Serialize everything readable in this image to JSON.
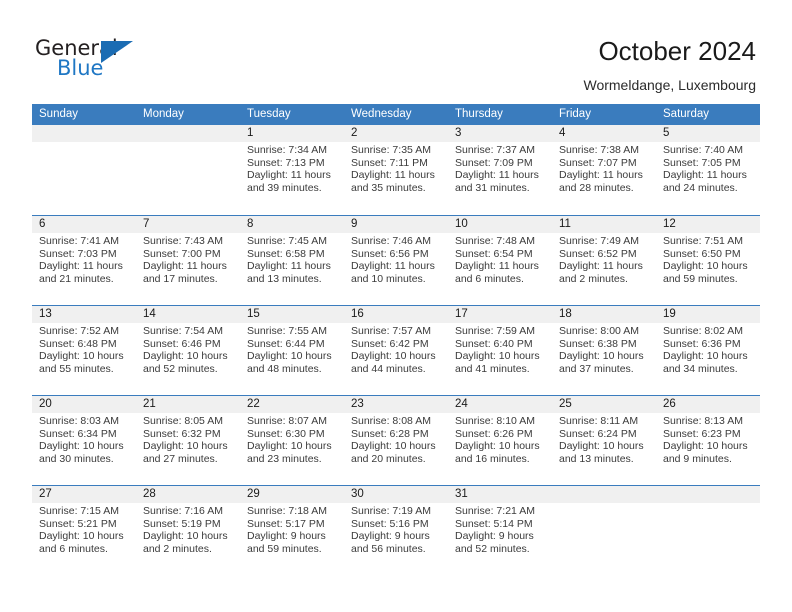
{
  "brand": {
    "name_part1": "General",
    "name_part2": "Blue",
    "triangle_icon": "triangle-icon",
    "colors": {
      "dark": "#231f20",
      "blue": "#1f77c4",
      "header_blue": "#3a7cbe"
    }
  },
  "header": {
    "title": "October 2024",
    "subtitle": "Wormeldange, Luxembourg"
  },
  "calendar": {
    "day_headers": [
      "Sunday",
      "Monday",
      "Tuesday",
      "Wednesday",
      "Thursday",
      "Friday",
      "Saturday"
    ],
    "weeks": [
      [
        {
          "day": "",
          "lines": []
        },
        {
          "day": "",
          "lines": []
        },
        {
          "day": "1",
          "lines": [
            "Sunrise: 7:34 AM",
            "Sunset: 7:13 PM",
            "Daylight: 11 hours",
            "and 39 minutes."
          ]
        },
        {
          "day": "2",
          "lines": [
            "Sunrise: 7:35 AM",
            "Sunset: 7:11 PM",
            "Daylight: 11 hours",
            "and 35 minutes."
          ]
        },
        {
          "day": "3",
          "lines": [
            "Sunrise: 7:37 AM",
            "Sunset: 7:09 PM",
            "Daylight: 11 hours",
            "and 31 minutes."
          ]
        },
        {
          "day": "4",
          "lines": [
            "Sunrise: 7:38 AM",
            "Sunset: 7:07 PM",
            "Daylight: 11 hours",
            "and 28 minutes."
          ]
        },
        {
          "day": "5",
          "lines": [
            "Sunrise: 7:40 AM",
            "Sunset: 7:05 PM",
            "Daylight: 11 hours",
            "and 24 minutes."
          ]
        }
      ],
      [
        {
          "day": "6",
          "lines": [
            "Sunrise: 7:41 AM",
            "Sunset: 7:03 PM",
            "Daylight: 11 hours",
            "and 21 minutes."
          ]
        },
        {
          "day": "7",
          "lines": [
            "Sunrise: 7:43 AM",
            "Sunset: 7:00 PM",
            "Daylight: 11 hours",
            "and 17 minutes."
          ]
        },
        {
          "day": "8",
          "lines": [
            "Sunrise: 7:45 AM",
            "Sunset: 6:58 PM",
            "Daylight: 11 hours",
            "and 13 minutes."
          ]
        },
        {
          "day": "9",
          "lines": [
            "Sunrise: 7:46 AM",
            "Sunset: 6:56 PM",
            "Daylight: 11 hours",
            "and 10 minutes."
          ]
        },
        {
          "day": "10",
          "lines": [
            "Sunrise: 7:48 AM",
            "Sunset: 6:54 PM",
            "Daylight: 11 hours",
            "and 6 minutes."
          ]
        },
        {
          "day": "11",
          "lines": [
            "Sunrise: 7:49 AM",
            "Sunset: 6:52 PM",
            "Daylight: 11 hours",
            "and 2 minutes."
          ]
        },
        {
          "day": "12",
          "lines": [
            "Sunrise: 7:51 AM",
            "Sunset: 6:50 PM",
            "Daylight: 10 hours",
            "and 59 minutes."
          ]
        }
      ],
      [
        {
          "day": "13",
          "lines": [
            "Sunrise: 7:52 AM",
            "Sunset: 6:48 PM",
            "Daylight: 10 hours",
            "and 55 minutes."
          ]
        },
        {
          "day": "14",
          "lines": [
            "Sunrise: 7:54 AM",
            "Sunset: 6:46 PM",
            "Daylight: 10 hours",
            "and 52 minutes."
          ]
        },
        {
          "day": "15",
          "lines": [
            "Sunrise: 7:55 AM",
            "Sunset: 6:44 PM",
            "Daylight: 10 hours",
            "and 48 minutes."
          ]
        },
        {
          "day": "16",
          "lines": [
            "Sunrise: 7:57 AM",
            "Sunset: 6:42 PM",
            "Daylight: 10 hours",
            "and 44 minutes."
          ]
        },
        {
          "day": "17",
          "lines": [
            "Sunrise: 7:59 AM",
            "Sunset: 6:40 PM",
            "Daylight: 10 hours",
            "and 41 minutes."
          ]
        },
        {
          "day": "18",
          "lines": [
            "Sunrise: 8:00 AM",
            "Sunset: 6:38 PM",
            "Daylight: 10 hours",
            "and 37 minutes."
          ]
        },
        {
          "day": "19",
          "lines": [
            "Sunrise: 8:02 AM",
            "Sunset: 6:36 PM",
            "Daylight: 10 hours",
            "and 34 minutes."
          ]
        }
      ],
      [
        {
          "day": "20",
          "lines": [
            "Sunrise: 8:03 AM",
            "Sunset: 6:34 PM",
            "Daylight: 10 hours",
            "and 30 minutes."
          ]
        },
        {
          "day": "21",
          "lines": [
            "Sunrise: 8:05 AM",
            "Sunset: 6:32 PM",
            "Daylight: 10 hours",
            "and 27 minutes."
          ]
        },
        {
          "day": "22",
          "lines": [
            "Sunrise: 8:07 AM",
            "Sunset: 6:30 PM",
            "Daylight: 10 hours",
            "and 23 minutes."
          ]
        },
        {
          "day": "23",
          "lines": [
            "Sunrise: 8:08 AM",
            "Sunset: 6:28 PM",
            "Daylight: 10 hours",
            "and 20 minutes."
          ]
        },
        {
          "day": "24",
          "lines": [
            "Sunrise: 8:10 AM",
            "Sunset: 6:26 PM",
            "Daylight: 10 hours",
            "and 16 minutes."
          ]
        },
        {
          "day": "25",
          "lines": [
            "Sunrise: 8:11 AM",
            "Sunset: 6:24 PM",
            "Daylight: 10 hours",
            "and 13 minutes."
          ]
        },
        {
          "day": "26",
          "lines": [
            "Sunrise: 8:13 AM",
            "Sunset: 6:23 PM",
            "Daylight: 10 hours",
            "and 9 minutes."
          ]
        }
      ],
      [
        {
          "day": "27",
          "lines": [
            "Sunrise: 7:15 AM",
            "Sunset: 5:21 PM",
            "Daylight: 10 hours",
            "and 6 minutes."
          ]
        },
        {
          "day": "28",
          "lines": [
            "Sunrise: 7:16 AM",
            "Sunset: 5:19 PM",
            "Daylight: 10 hours",
            "and 2 minutes."
          ]
        },
        {
          "day": "29",
          "lines": [
            "Sunrise: 7:18 AM",
            "Sunset: 5:17 PM",
            "Daylight: 9 hours",
            "and 59 minutes."
          ]
        },
        {
          "day": "30",
          "lines": [
            "Sunrise: 7:19 AM",
            "Sunset: 5:16 PM",
            "Daylight: 9 hours",
            "and 56 minutes."
          ]
        },
        {
          "day": "31",
          "lines": [
            "Sunrise: 7:21 AM",
            "Sunset: 5:14 PM",
            "Daylight: 9 hours",
            "and 52 minutes."
          ]
        },
        {
          "day": "",
          "lines": []
        },
        {
          "day": "",
          "lines": []
        }
      ]
    ]
  }
}
